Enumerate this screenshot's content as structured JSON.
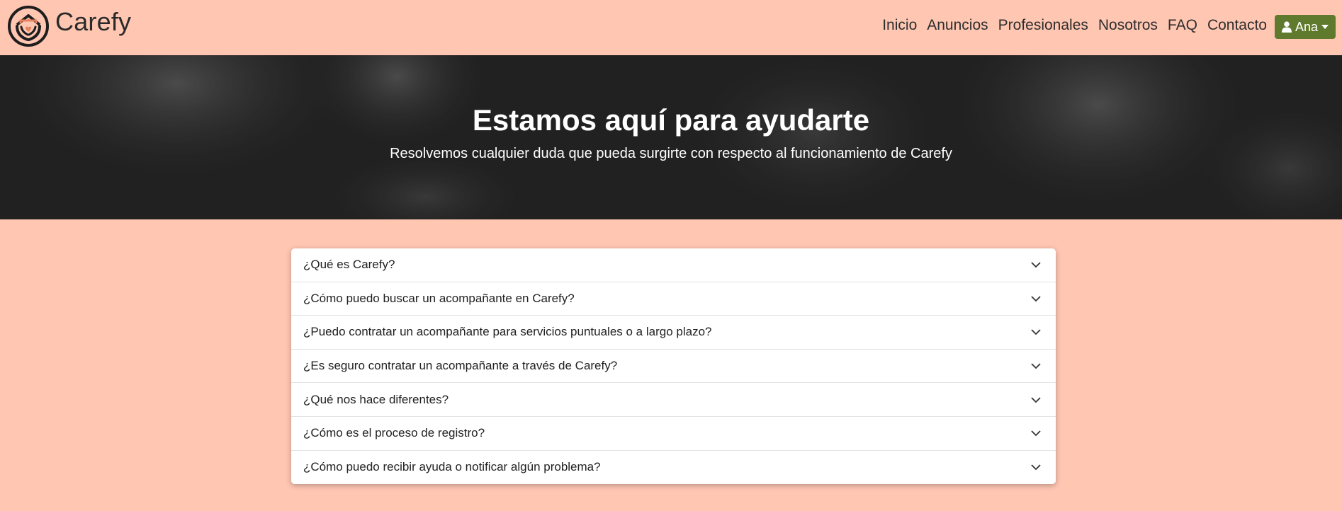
{
  "brand": {
    "name": "Carefy"
  },
  "nav": {
    "links": [
      "Inicio",
      "Anuncios",
      "Profesionales",
      "Nosotros",
      "FAQ",
      "Contacto"
    ],
    "user_label": "Ana"
  },
  "hero": {
    "title": "Estamos aquí para ayudarte",
    "subtitle": "Resolvemos cualquier duda que pueda surgirte con respecto al funcionamiento de Carefy"
  },
  "faq": {
    "items": [
      "¿Qué es Carefy?",
      "¿Cómo puedo buscar un acompañante en Carefy?",
      "¿Puedo contratar un acompañante para servicios puntuales o a largo plazo?",
      "¿Es seguro contratar un acompañante a través de Carefy?",
      "¿Qué nos hace diferentes?",
      "¿Cómo es el proceso de registro?",
      "¿Cómo puedo recibir ayuda o notificar algún problema?"
    ]
  },
  "colors": {
    "page_bg": "#ffc6b2",
    "user_button": "#5f7a2c",
    "hero_overlay": "#2b2b2b"
  },
  "icons": {
    "logo": "house-hands-logo",
    "user": "user-icon",
    "caret": "caret-down-icon",
    "chevron": "chevron-down-icon"
  }
}
